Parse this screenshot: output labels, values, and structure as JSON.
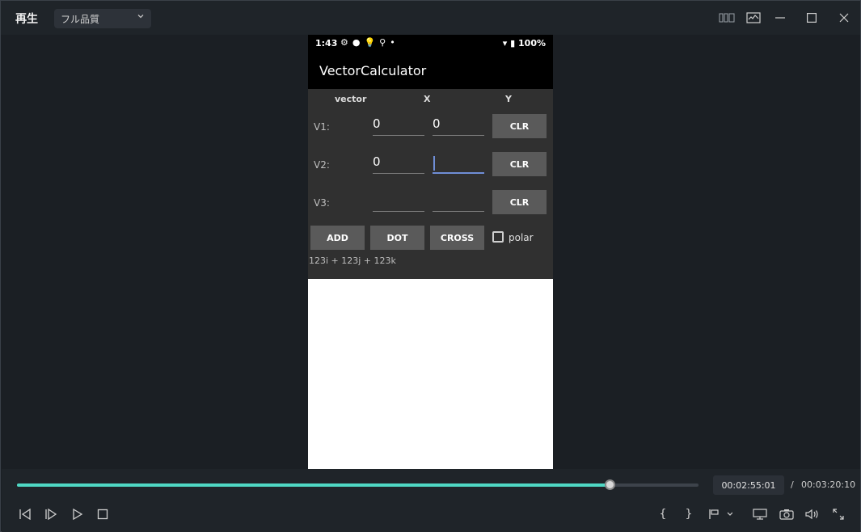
{
  "window": {
    "title": "再生",
    "quality": {
      "selected": "フル品質"
    }
  },
  "phone": {
    "status": {
      "time": "1:43",
      "battery": "100%"
    },
    "app_title": "VectorCalculator",
    "headers": {
      "vector": "vector",
      "x": "X",
      "y": "Y"
    },
    "rows": [
      {
        "label": "V1:",
        "x": "0",
        "y": "0",
        "clear": "CLR"
      },
      {
        "label": "V2:",
        "x": "0",
        "y": "",
        "clear": "CLR"
      },
      {
        "label": "V3:",
        "x": "",
        "y": "",
        "clear": "CLR"
      }
    ],
    "actions": {
      "add": "ADD",
      "dot": "DOT",
      "cross": "CROSS"
    },
    "polar": {
      "label": "polar",
      "checked": false
    },
    "result": "123i + 123j + 123k"
  },
  "player": {
    "current_time": "00:02:55:01",
    "separator": "/",
    "total_time": "00:03:20:10",
    "progress": 0.869,
    "accent_color": "#4fd8c4"
  },
  "icons": {
    "titlebar": [
      "layout-icon",
      "monitor-chart-icon",
      "minimize-icon",
      "maximize-icon",
      "close-icon"
    ],
    "controls": [
      "prev-frame-icon",
      "next-frame-icon",
      "play-icon",
      "stop-icon",
      "mark-in-icon",
      "mark-out-icon",
      "marker-icon",
      "display-icon",
      "snapshot-icon",
      "volume-icon",
      "fullscreen-icon"
    ]
  }
}
